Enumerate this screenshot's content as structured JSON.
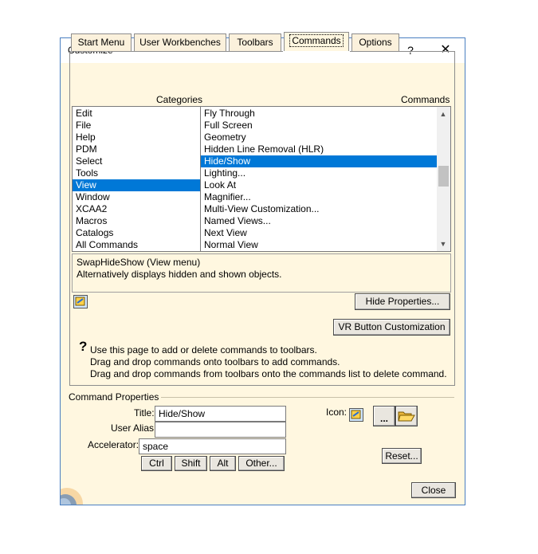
{
  "window": {
    "title": "Customize",
    "help_glyph": "?",
    "close_glyph": "✕"
  },
  "tabs": [
    {
      "label": "Start Menu"
    },
    {
      "label": "User Workbenches"
    },
    {
      "label": "Toolbars"
    },
    {
      "label": "Commands",
      "active": true
    },
    {
      "label": "Options"
    }
  ],
  "categories": {
    "header": "Categories",
    "items": [
      "Edit",
      "File",
      "Help",
      "PDM",
      "Select",
      "Tools",
      "View",
      "Window",
      "XCAA2",
      "Macros",
      "Catalogs",
      "All Commands"
    ],
    "selected": "View"
  },
  "commands": {
    "header": "Commands",
    "items": [
      "Fly Through",
      "Full Screen",
      "Geometry",
      "Hidden Line Removal (HLR)",
      "Hide/Show",
      "Lighting...",
      "Look At",
      "Magnifier...",
      "Multi-View Customization...",
      "Named Views...",
      "Next View",
      "Normal View"
    ],
    "selected": "Hide/Show",
    "scroll_up_glyph": "▲",
    "scroll_down_glyph": "▼"
  },
  "description": {
    "line1": "SwapHideShow (View menu)",
    "line2": "Alternatively displays hidden and shown objects."
  },
  "buttons": {
    "hide_properties": "Hide Properties...",
    "vr_customization": "VR Button Customization",
    "ctrl": "Ctrl",
    "shift": "Shift",
    "alt": "Alt",
    "other": "Other...",
    "icon_browse": "...",
    "reset": "Reset...",
    "close": "Close"
  },
  "help": {
    "glyph": "?",
    "line1": "Use this page to add or delete commands to toolbars.",
    "line2": "Drag and drop commands onto toolbars to add commands.",
    "line3": "Drag and drop commands from toolbars onto the commands list to delete command."
  },
  "command_properties": {
    "group_label": "Command Properties",
    "title_label": "Title:",
    "title_value": "Hide/Show",
    "alias_label": "User Alias:",
    "alias_value": "",
    "accelerator_label": "Accelerator:",
    "accelerator_value": "space",
    "icon_label": "Icon:"
  },
  "colors": {
    "selection": "#0078d7",
    "dialog_bg": "#fff7e0",
    "window_border": "#4a7fc1"
  },
  "icons": {
    "command_icon": "hide-show-icon",
    "folder": "folder-open-icon"
  }
}
